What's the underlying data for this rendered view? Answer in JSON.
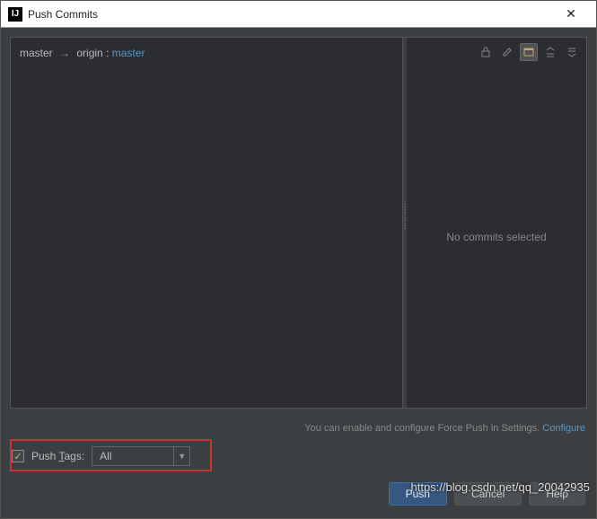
{
  "titlebar": {
    "icon_text": "IJ",
    "title": "Push Commits",
    "close": "✕"
  },
  "branch": {
    "local": "master",
    "separator": "→",
    "remote_name": "origin",
    "sep2": ":",
    "remote_branch": "master"
  },
  "right_panel": {
    "empty_text": "No commits selected"
  },
  "hint": {
    "text": "You can enable and configure Force Push in Settings. ",
    "link": "Configure"
  },
  "push_tags": {
    "checked": "✓",
    "label_pre": "Push ",
    "label_u": "T",
    "label_post": "ags:",
    "selected": "All",
    "arrow": "▼"
  },
  "buttons": {
    "push": "Push",
    "cancel": "Cancel",
    "help": "Help"
  },
  "watermark": "https://blog.csdn.net/qq_20042935"
}
